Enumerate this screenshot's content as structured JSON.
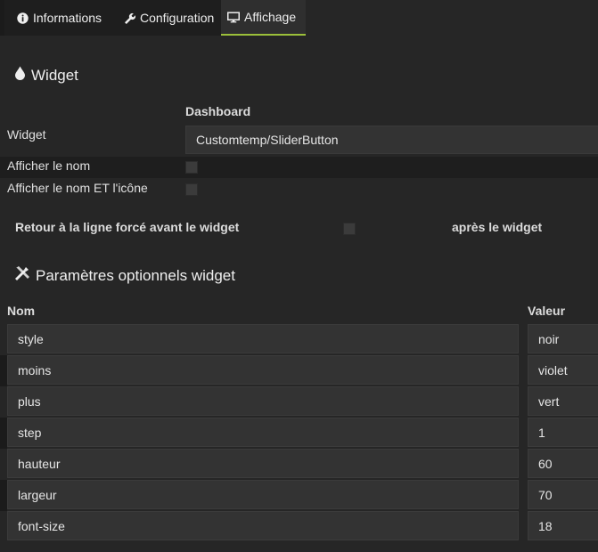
{
  "tabs": [
    {
      "label": "Informations",
      "icon": "info-circle-icon"
    },
    {
      "label": "Configuration",
      "icon": "wrench-icon"
    },
    {
      "label": "Affichage",
      "icon": "desktop-icon",
      "active": true
    }
  ],
  "widget_section": {
    "title": "Widget",
    "icon": "tint-icon",
    "column_header": "Dashboard",
    "widget_label": "Widget",
    "widget_value": "Customtemp/SliderButton",
    "show_name_label": "Afficher le nom",
    "show_name_and_icon_label": "Afficher le nom ET l'icône",
    "line_break_before_label": "Retour à la ligne forcé avant le widget",
    "line_break_after_label": "après le widget"
  },
  "params_section": {
    "title": "Paramètres optionnels widget",
    "icon": "tools-icon",
    "col_name": "Nom",
    "col_value": "Valeur",
    "rows": [
      {
        "name": "style",
        "value": "noir"
      },
      {
        "name": "moins",
        "value": "violet"
      },
      {
        "name": "plus",
        "value": "vert"
      },
      {
        "name": "step",
        "value": "1"
      },
      {
        "name": "hauteur",
        "value": "60"
      },
      {
        "name": "largeur",
        "value": "70"
      },
      {
        "name": "font-size",
        "value": "18"
      }
    ]
  },
  "colors": {
    "background": "#262626",
    "field": "#333333",
    "active_tab_underline": "#9bbf3a"
  }
}
